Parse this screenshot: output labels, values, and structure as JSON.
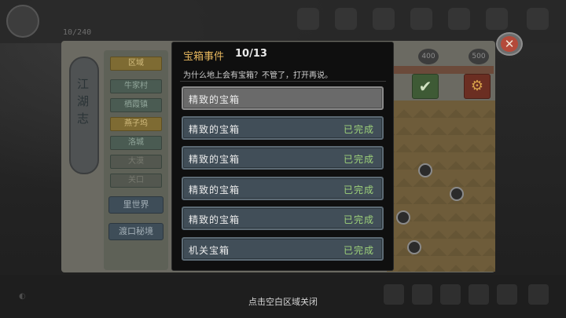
{
  "background": {
    "stamina": "10/240",
    "side_panel": {
      "scroll_title_chars": [
        "江",
        "湖",
        "志"
      ],
      "section_label": "区域",
      "regions": [
        "牛家村",
        "栖霞镇",
        "燕子坞",
        "洛城",
        "大漠",
        "关口"
      ],
      "selected_region": "燕子坞",
      "buttons": [
        "里世界",
        "渡口秘境"
      ]
    },
    "costs": [
      "400",
      "500"
    ]
  },
  "dialog": {
    "title": "宝箱事件",
    "progress": "10/13",
    "subtitle": "为什么地上会有宝箱？不管了，打开再说。",
    "items": [
      {
        "name": "精致的宝箱",
        "status": ""
      },
      {
        "name": "精致的宝箱",
        "status": "已完成"
      },
      {
        "name": "精致的宝箱",
        "status": "已完成"
      },
      {
        "name": "精致的宝箱",
        "status": "已完成"
      },
      {
        "name": "精致的宝箱",
        "status": "已完成"
      },
      {
        "name": "机关宝箱",
        "status": "已完成"
      }
    ]
  },
  "hint": "点击空白区域关闭",
  "colors": {
    "title_gold": "#e5b65d",
    "completed_green": "#9ed27a",
    "row_bg": "#414e58",
    "row_selected_bg": "#6a6a6a"
  }
}
